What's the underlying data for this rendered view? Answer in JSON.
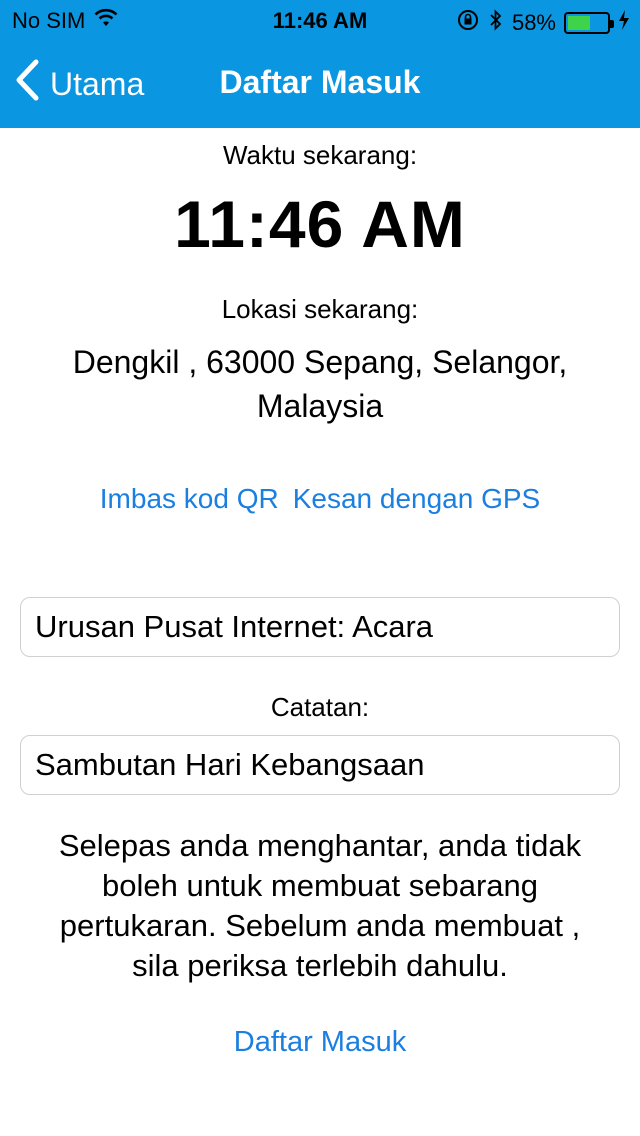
{
  "status_bar": {
    "carrier": "No SIM",
    "time": "11:46 AM",
    "battery_percent": "58%",
    "battery_level": 0.58,
    "icons": [
      "wifi-icon",
      "rotation-lock-icon",
      "bluetooth-icon",
      "battery-icon",
      "charging-icon"
    ]
  },
  "nav": {
    "back_label": "Utama",
    "title": "Daftar Masuk"
  },
  "main": {
    "time_label": "Waktu sekarang:",
    "time_value": "11:46 AM",
    "location_label": "Lokasi sekarang:",
    "location_line1": "Dengkil , 63000 Sepang, Selangor,",
    "location_line2": "Malaysia",
    "scan_qr_label": "Imbas kod QR",
    "gps_label": "Kesan dengan GPS",
    "purpose_value": "Urusan Pusat Internet: Acara",
    "notes_label": "Catatan:",
    "notes_value": "Sambutan Hari Kebangsaan",
    "notice_line1": "Selepas anda menghantar, anda tidak",
    "notice_line2": "boleh untuk membuat sebarang",
    "notice_line3": "pertukaran. Sebelum anda membuat ,",
    "notice_line4": "sila periksa terlebih dahulu.",
    "submit_label": "Daftar Masuk"
  },
  "colors": {
    "header_bg": "#0a96e0",
    "link": "#1a7fe0",
    "battery_fill": "#3fd34b"
  }
}
